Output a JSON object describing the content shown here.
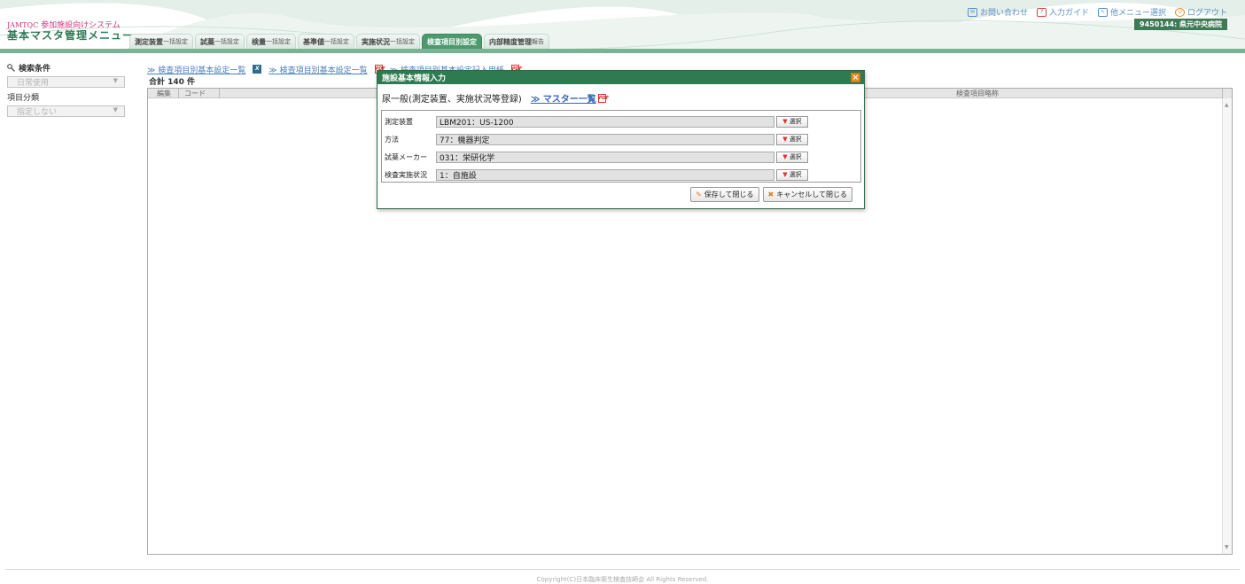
{
  "header": {
    "brand_tag": "JAMTQC",
    "brand_text": "参加施設向けシステム",
    "app_title": "基本マスタ管理メニュー",
    "tabs": [
      {
        "label": "測定装置",
        "suffix": "一括設定"
      },
      {
        "label": "試薬",
        "suffix": "一括設定"
      },
      {
        "label": "検量",
        "suffix": "一括設定"
      },
      {
        "label": "基準値",
        "suffix": "一括設定"
      },
      {
        "label": "実施状況",
        "suffix": "一括設定"
      },
      {
        "label": "検査項目別設定",
        "suffix": ""
      },
      {
        "label": "内部精度管理",
        "suffix": "報告"
      }
    ],
    "links": {
      "contact": "お問い合わせ",
      "guide": "入力ガイド",
      "other_menu": "他メニュー選択",
      "logout": "ログアウト"
    },
    "facility": "9450144: 県元中央病院"
  },
  "left_panel": {
    "search_title": "検索条件",
    "usage_select": "日常使用",
    "category_label": "項目分類",
    "category_select": "指定しない"
  },
  "main": {
    "link1": "≫ 検査項目別基本設定一覧",
    "link2": "≫ 検査項目別基本設定一覧",
    "link3": "≫ 検査項目別基本設定記入用紙",
    "total": "合計 140 件",
    "columns": {
      "edit": "編集",
      "code": "コード",
      "short_name": "検査項目略称"
    }
  },
  "dialog": {
    "title": "施設基本情報入力",
    "subtitle": "尿一般(測定装置、実施状況等登録)",
    "master_link": "≫ マスター一覧",
    "fields": [
      {
        "label": "測定装置",
        "value": "LBM201：US-1200"
      },
      {
        "label": "方法",
        "value": "77：機器判定"
      },
      {
        "label": "試薬メーカー",
        "value": "031：栄研化学"
      },
      {
        "label": "検査実施状況",
        "value": "1：自施設"
      }
    ],
    "select_label": "選択",
    "save_button": "保存して閉じる",
    "cancel_button": "キャンセルして閉じる"
  },
  "footer": {
    "copyright": "Copyright(C)日本臨床衛生検査技師会 All Rights Reserved."
  }
}
